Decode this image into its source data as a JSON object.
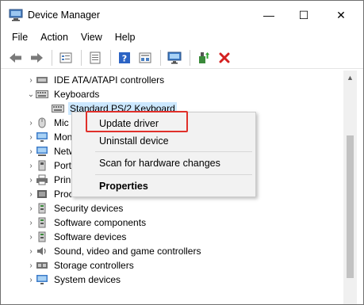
{
  "window": {
    "title": "Device Manager",
    "minimize_glyph": "—",
    "maximize_glyph": "☐",
    "close_glyph": "✕"
  },
  "menu": {
    "items": [
      "File",
      "Action",
      "View",
      "Help"
    ]
  },
  "toolbar": {
    "icons": [
      "back-arrow-icon",
      "forward-arrow-icon",
      "device-tree-icon",
      "properties-icon",
      "help-icon",
      "view-icon",
      "monitor-icon",
      "update-driver-icon",
      "uninstall-icon"
    ],
    "uninstall_color": "#d42020"
  },
  "tree": {
    "rows": [
      {
        "label": "IDE ATA/ATAPI controllers",
        "chevron": "›"
      },
      {
        "label": "Keyboards",
        "chevron": "⌄"
      },
      {
        "label": "Standard PS/2 Keyboard",
        "chevron": ""
      },
      {
        "label": "Mic",
        "chevron": "›"
      },
      {
        "label": "Mon",
        "chevron": "›"
      },
      {
        "label": "Netw",
        "chevron": "›"
      },
      {
        "label": "Port",
        "chevron": "›"
      },
      {
        "label": "Prin",
        "chevron": "›"
      },
      {
        "label": "Proc",
        "chevron": "›"
      },
      {
        "label": "Security devices",
        "chevron": "›"
      },
      {
        "label": "Software components",
        "chevron": "›"
      },
      {
        "label": "Software devices",
        "chevron": "›"
      },
      {
        "label": "Sound, video and game controllers",
        "chevron": "›"
      },
      {
        "label": "Storage controllers",
        "chevron": "›"
      },
      {
        "label": "System devices",
        "chevron": "›"
      }
    ]
  },
  "context_menu": {
    "update_driver": "Update driver",
    "uninstall_device": "Uninstall device",
    "scan_hardware": "Scan for hardware changes",
    "properties": "Properties",
    "highlight_color": "#e0302a"
  },
  "scrollbar": {
    "up_glyph": "▲"
  }
}
